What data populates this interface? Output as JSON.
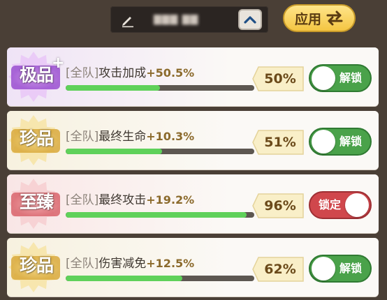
{
  "header": {
    "name_value": "▇▇▇ ▇▇",
    "apply_label": "应用",
    "icons": {
      "edit": "pencil-icon",
      "collapse": "chevron-up-icon",
      "apply": "swap-arrows-icon"
    }
  },
  "colors": {
    "bar_fill": "#5fd15a",
    "toggle_unlocked": "#4aa24a",
    "toggle_locked": "#d0474c",
    "value_text": "#8b6a2c"
  },
  "affixes": [
    {
      "rarity": "极品",
      "rarity_suffix": "+",
      "rarity_theme": "purple",
      "scope": "[全队]",
      "name": "攻击加成",
      "value": "+50.5%",
      "percent_label": "50%",
      "percent": 0.5,
      "toggle_label": "解锁",
      "locked": false
    },
    {
      "rarity": "珍品",
      "rarity_suffix": "",
      "rarity_theme": "gold",
      "scope": "[全队]",
      "name": "最终生命",
      "value": "+10.3%",
      "percent_label": "51%",
      "percent": 0.51,
      "toggle_label": "解锁",
      "locked": false
    },
    {
      "rarity": "至臻",
      "rarity_suffix": "",
      "rarity_theme": "red",
      "scope": "[全队]",
      "name": "最终攻击",
      "value": "+19.2%",
      "percent_label": "96%",
      "percent": 0.96,
      "toggle_label": "锁定",
      "locked": true
    },
    {
      "rarity": "珍品",
      "rarity_suffix": "",
      "rarity_theme": "gold",
      "scope": "[全队]",
      "name": "伤害减免",
      "value": "+12.5%",
      "percent_label": "62%",
      "percent": 0.62,
      "toggle_label": "解锁",
      "locked": false
    }
  ]
}
